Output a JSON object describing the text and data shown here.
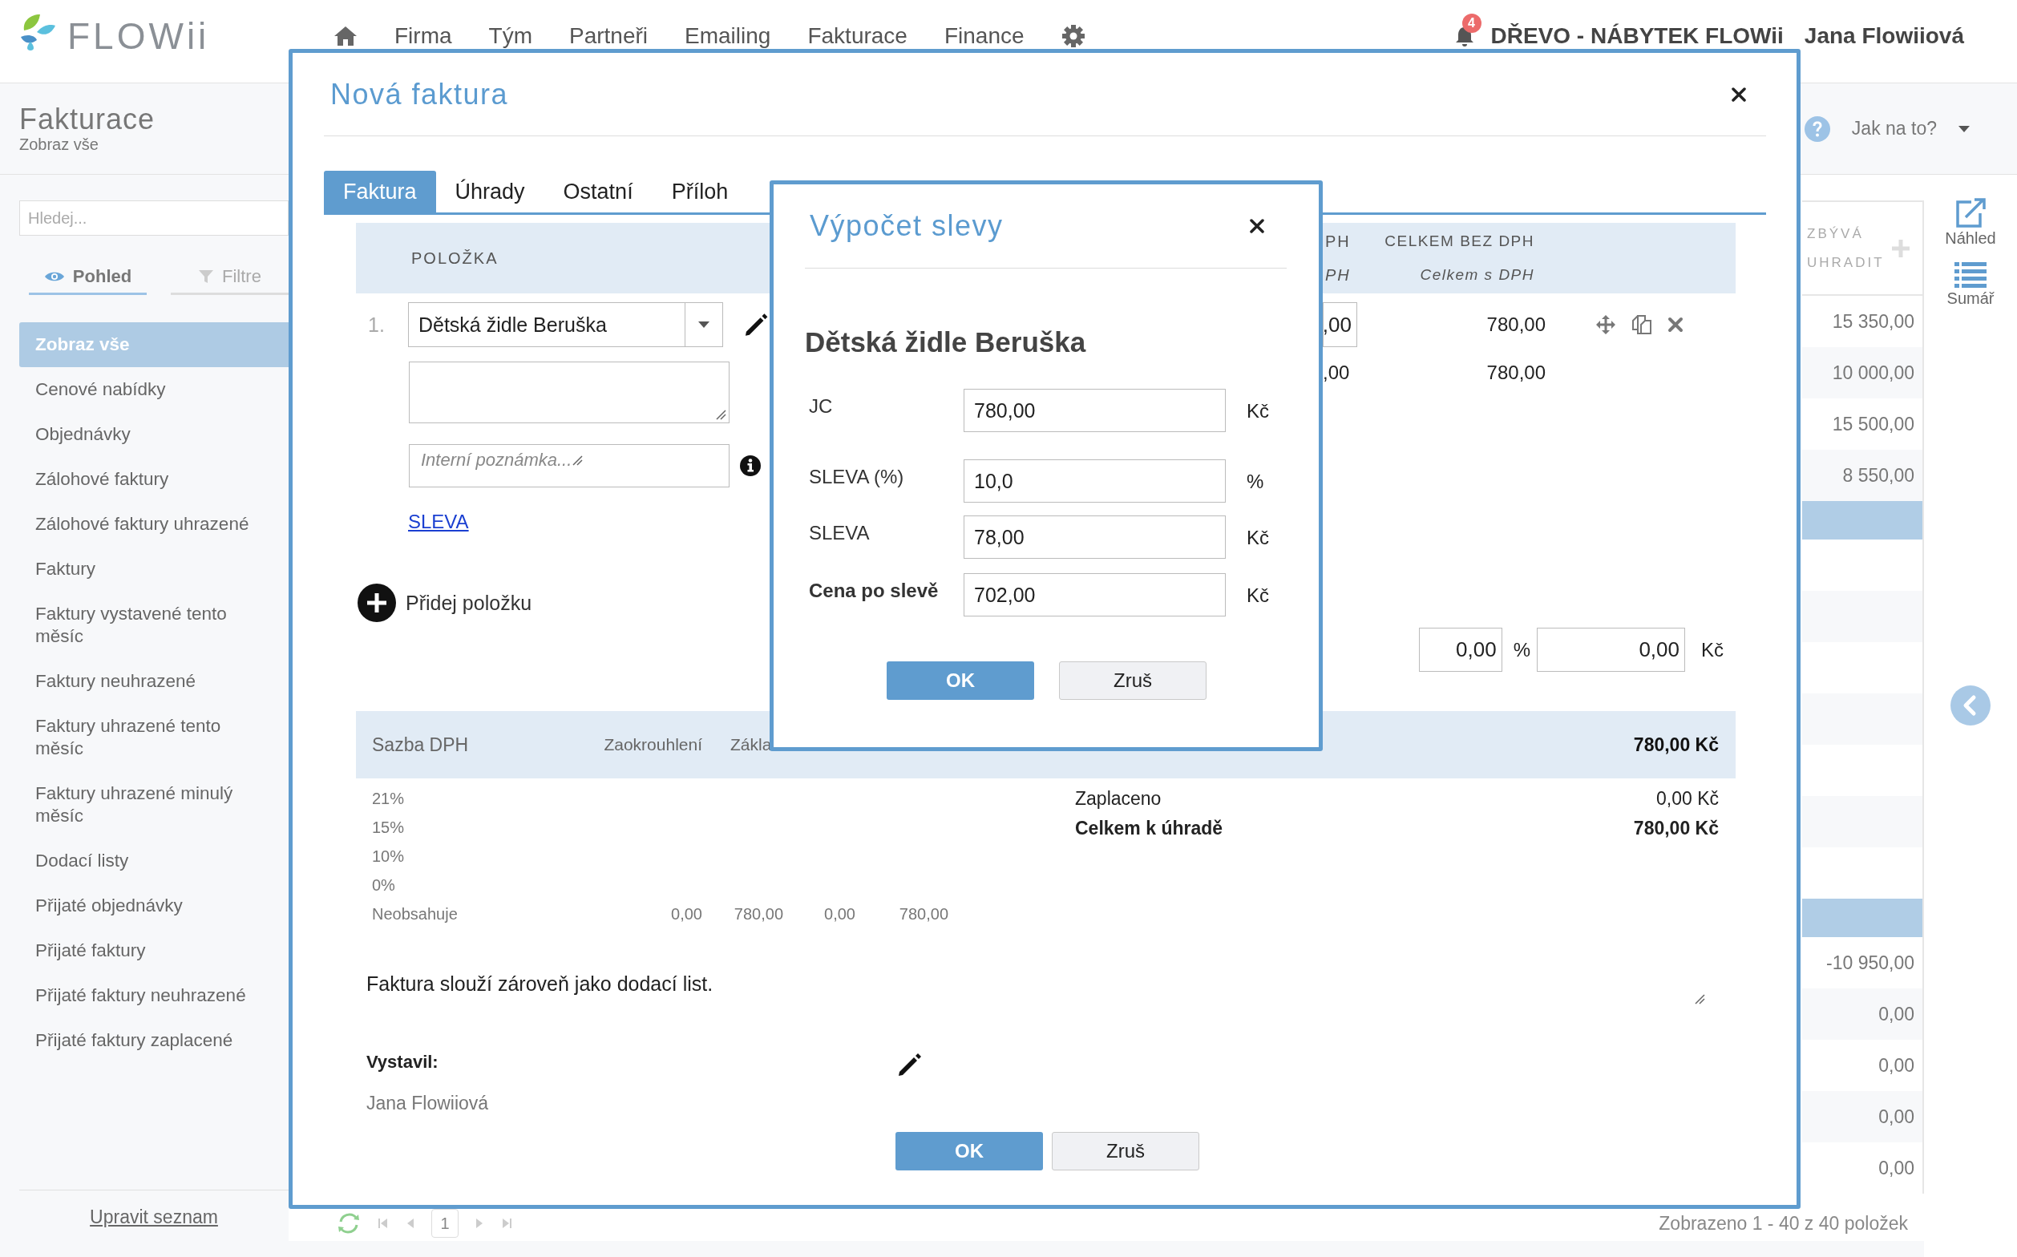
{
  "app": {
    "logo": "FLOWii"
  },
  "nav": {
    "items": [
      {
        "label": "Firma"
      },
      {
        "label": "Tým"
      },
      {
        "label": "Partneři"
      },
      {
        "label": "Emailing"
      },
      {
        "label": "Fakturace"
      },
      {
        "label": "Finance"
      }
    ],
    "notifications": "4",
    "company": "DŘEVO - NÁBYTEK FLOWii",
    "user": "Jana Flowiiová"
  },
  "section": {
    "title": "Fakturace",
    "subtitle": "Zobraz vše",
    "help": "Jak na to?"
  },
  "sidebar": {
    "search_placeholder": "Hledej...",
    "view_tabs": [
      {
        "label": "Pohled",
        "kind": "view",
        "selected": true
      },
      {
        "label": "Filtre",
        "kind": "filter",
        "selected": false
      }
    ],
    "items": [
      {
        "label": "Zobraz vše",
        "selected": true
      },
      {
        "label": "Cenové nabídky",
        "selected": false
      },
      {
        "label": "Objednávky",
        "selected": false
      },
      {
        "label": "Zálohové faktury",
        "selected": false
      },
      {
        "label": "Zálohové faktury uhrazené",
        "selected": false
      },
      {
        "label": "Faktury",
        "selected": false
      },
      {
        "label": "Faktury vystavené tento měsíc",
        "selected": false
      },
      {
        "label": "Faktury neuhrazené",
        "selected": false
      },
      {
        "label": "Faktury uhrazené tento měsíc",
        "selected": false
      },
      {
        "label": "Faktury uhrazené minulý měsíc",
        "selected": false
      },
      {
        "label": "Dodací listy",
        "selected": false
      },
      {
        "label": "Přijaté objednávky",
        "selected": false
      },
      {
        "label": "Přijaté faktury",
        "selected": false
      },
      {
        "label": "Přijaté faktury neuhrazené",
        "selected": false
      },
      {
        "label": "Přijaté faktury zaplacené",
        "selected": false
      }
    ],
    "edit_link": "Upravit seznam"
  },
  "list": {
    "column": "ZBÝVÁ UHRADIT",
    "rows": [
      {
        "value": "15 350,00",
        "selected": false
      },
      {
        "value": "10 000,00",
        "selected": false
      },
      {
        "value": "15 500,00",
        "selected": false
      },
      {
        "value": "8 550,00",
        "selected": false
      },
      {
        "selected": true
      },
      {
        "selected": false
      },
      {
        "selected": false
      },
      {
        "selected": false
      },
      {
        "selected": false
      },
      {
        "selected": false
      },
      {
        "selected": false
      },
      {
        "selected": false
      },
      {
        "selected": true
      },
      {
        "value": "-10 950,00",
        "selected": false
      },
      {
        "value": "0,00",
        "selected": false
      },
      {
        "value": "0,00",
        "selected": false
      },
      {
        "value": "0,00",
        "selected": false
      },
      {
        "value": "0,00",
        "selected": false
      }
    ]
  },
  "pagination": {
    "page": "1",
    "status": "Zobrazeno 1 - 40 z 40 položek"
  },
  "tools": [
    {
      "label": "Náhled",
      "kind": "preview"
    },
    {
      "label": "Sumář",
      "kind": "summary"
    }
  ],
  "invoice_modal": {
    "title": "Nová faktura",
    "tabs": [
      {
        "label": "Faktura",
        "selected": true
      },
      {
        "label": "Úhrady",
        "selected": false
      },
      {
        "label": "Ostatní",
        "selected": false
      },
      {
        "label": "Příloh",
        "selected": false
      }
    ],
    "items_header": {
      "item": "POLOŽKA",
      "column_1": "PH",
      "column_1_sub": "PH",
      "total_without_vat": "CELKEM BEZ DPH",
      "total_with_vat": "Celkem s DPH"
    },
    "items": [
      {
        "number": "1.",
        "product": "Dětská židle Beruška",
        "note_placeholder": "Interní poznámka...",
        "discount_link": "SLEVA",
        "column_1_field": ",00",
        "column_1_value": ",00",
        "total_without_vat": "780,00",
        "total_with_vat": "780,00"
      }
    ],
    "add_item": "Přidej položku",
    "discount": {
      "percent": "0,00",
      "percent_unit": "%",
      "amount": "0,00",
      "amount_unit": "Kč"
    },
    "vat": {
      "columns": [
        "Sazba DPH",
        "Zaokrouhlení",
        "Zákla"
      ],
      "total": "780,00 Kč",
      "rows": [
        {
          "rate": "21%"
        },
        {
          "rate": "15%"
        },
        {
          "rate": "10%"
        },
        {
          "rate": "0%"
        },
        {
          "rate": "Neobsahuje",
          "values": [
            "0,00",
            "780,00",
            "0,00",
            "780,00"
          ]
        }
      ]
    },
    "summary": [
      {
        "label": "Zaplaceno",
        "value": "0,00 Kč",
        "bold": false
      },
      {
        "label": "Celkem k úhradě",
        "value": "780,00 Kč",
        "bold": true
      }
    ],
    "note": "Faktura slouží zároveň jako dodací list.",
    "issued_by": {
      "label": "Vystavil:",
      "name": "Jana Flowiiová"
    },
    "buttons": [
      {
        "label": "OK",
        "kind": "primary"
      },
      {
        "label": "Zruš",
        "kind": "secondary"
      }
    ]
  },
  "discount_dialog": {
    "title": "Výpočet slevy",
    "product": "Dětská židle Beruška",
    "fields": [
      {
        "label": "JC",
        "value": "780,00",
        "unit": "Kč",
        "bold": false
      },
      {
        "label": "SLEVA (%)",
        "value": "10,0",
        "unit": "%",
        "bold": false
      },
      {
        "label": "SLEVA",
        "value": "78,00",
        "unit": "Kč",
        "bold": false
      },
      {
        "label": "Cena po slevě",
        "value": "702,00",
        "unit": "Kč",
        "bold": true
      }
    ],
    "buttons": [
      {
        "label": "OK",
        "kind": "primary"
      },
      {
        "label": "Zruš",
        "kind": "secondary"
      }
    ]
  }
}
